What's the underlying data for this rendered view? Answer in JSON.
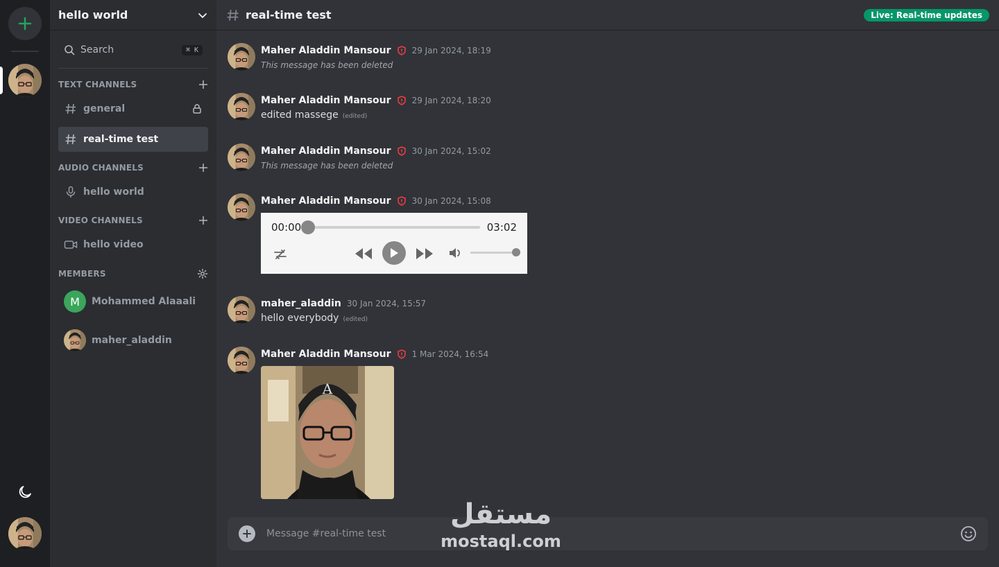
{
  "server": {
    "name": "hello world"
  },
  "search": {
    "label": "Search",
    "shortcut": "⌘ K"
  },
  "sections": {
    "text": {
      "title": "TEXT CHANNELS"
    },
    "audio": {
      "title": "AUDIO CHANNELS"
    },
    "video": {
      "title": "VIDEO CHANNELS"
    },
    "members": {
      "title": "MEMBERS"
    }
  },
  "channels": {
    "text": [
      {
        "name": "general",
        "locked": true,
        "active": false
      },
      {
        "name": "real-time test",
        "locked": false,
        "active": true
      }
    ],
    "audio": [
      {
        "name": "hello world"
      }
    ],
    "video": [
      {
        "name": "hello video"
      }
    ]
  },
  "members": [
    {
      "name": "Mohammed Alaaali",
      "initial": "M"
    },
    {
      "name": "maher_aladdin"
    }
  ],
  "chat": {
    "title": "real-time test",
    "live_badge": "Live: Real-time updates",
    "placeholder": "Message #real-time test"
  },
  "messages": [
    {
      "author": "Maher Aladdin Mansour",
      "admin": true,
      "time": "29 Jan 2024, 18:19",
      "deleted": "This message has been deleted"
    },
    {
      "author": "Maher Aladdin Mansour",
      "admin": true,
      "time": "29 Jan 2024, 18:20",
      "text": "edited massege",
      "edited": "(edited)"
    },
    {
      "author": "Maher Aladdin Mansour",
      "admin": true,
      "time": "30 Jan 2024, 15:02",
      "deleted": "This message has been deleted"
    },
    {
      "author": "Maher Aladdin Mansour",
      "admin": true,
      "time": "30 Jan 2024, 15:08",
      "audio": {
        "current": "00:00",
        "duration": "03:02",
        "progress": 0,
        "volume": 1.0
      }
    },
    {
      "author": "maher_aladdin",
      "admin": false,
      "time": "30 Jan 2024, 15:57",
      "text": "hello everybody",
      "edited": "(edited)"
    },
    {
      "author": "Maher Aladdin Mansour",
      "admin": true,
      "time": "1 Mar 2024, 16:54",
      "image": true
    }
  ],
  "watermark": {
    "arabic": "مستقل",
    "latin": "mostaql.com"
  },
  "colors": {
    "accent_green": "#23a55a",
    "live_badge": "#059669",
    "admin_shield": "#f23f43",
    "active_channel": "#404249"
  }
}
